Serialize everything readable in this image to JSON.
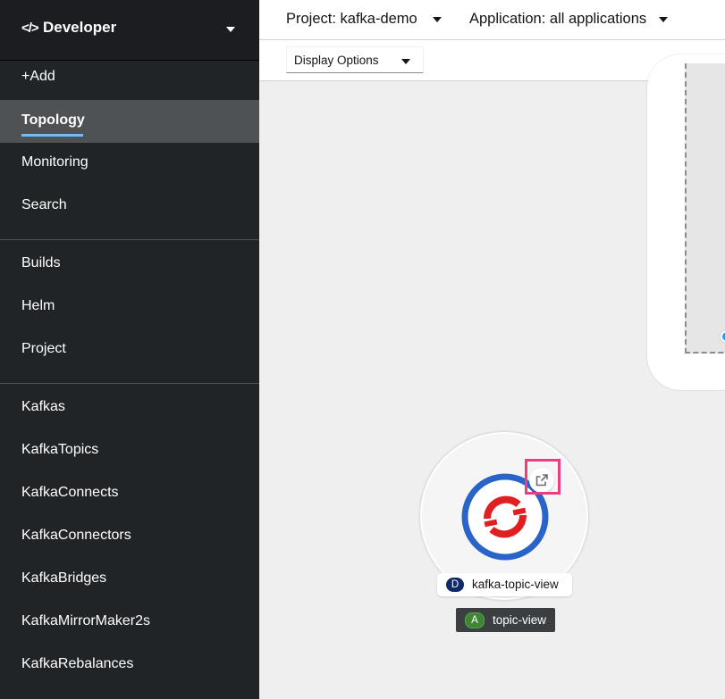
{
  "perspective": {
    "code_glyph": "</>",
    "title": "Developer"
  },
  "nav": {
    "add": "+Add",
    "topology": "Topology",
    "monitoring": "Monitoring",
    "search": "Search",
    "builds": "Builds",
    "helm": "Helm",
    "project": "Project",
    "kafkas": "Kafkas",
    "kafkatopics": "KafkaTopics",
    "kafkaconnects": "KafkaConnects",
    "kafkaconnectors": "KafkaConnectors",
    "kafkabridges": "KafkaBridges",
    "kafkamirrormaker2s": "KafkaMirrorMaker2s",
    "kafkarebalances": "KafkaRebalances"
  },
  "header": {
    "project": "Project: kafka-demo",
    "application": "Application: all applications"
  },
  "toolbar": {
    "display_options": "Display Options"
  },
  "topology": {
    "deployment": {
      "badge": "D",
      "name": "kafka-topic-view"
    },
    "application": {
      "badge": "A",
      "name": "topic-view"
    }
  },
  "colors": {
    "sidebar_bg": "#212427",
    "active_underline": "#73bcf7",
    "highlight": "#ec3e7e",
    "deployment_badge": "#0e2a68",
    "application_badge": "#3e8635"
  },
  "icons": [
    "caret-down-icon",
    "external-link-icon",
    "openshift-icon"
  ]
}
